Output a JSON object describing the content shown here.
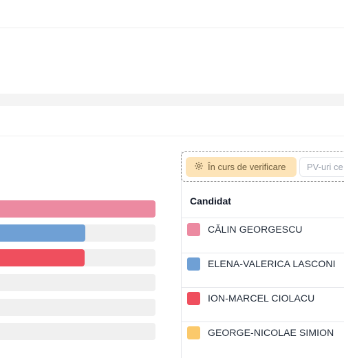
{
  "toolbar": {
    "verification_label": "În curs de verificare",
    "pv_label": "PV-uri ce"
  },
  "table": {
    "header_candidate": "Candidat"
  },
  "candidates": [
    {
      "name": "CĂLIN GEORGESCU",
      "color": "#ec8aa1",
      "bar_fraction": 1.0
    },
    {
      "name": "ELENA-VALERICA LASCONI",
      "color": "#6fa0d5",
      "bar_fraction": 0.55
    },
    {
      "name": "ION-MARCEL CIOLACU",
      "color": "#ef4f5e",
      "bar_fraction": 0.545
    },
    {
      "name": "GEORGE-NICOLAE SIMION",
      "color": "#fbc96b",
      "bar_fraction": 0.0
    }
  ],
  "extra_bars": [
    {
      "bar_fraction": 0.0
    },
    {
      "bar_fraction": 0.0
    },
    {
      "bar_fraction": 0.0
    }
  ]
}
